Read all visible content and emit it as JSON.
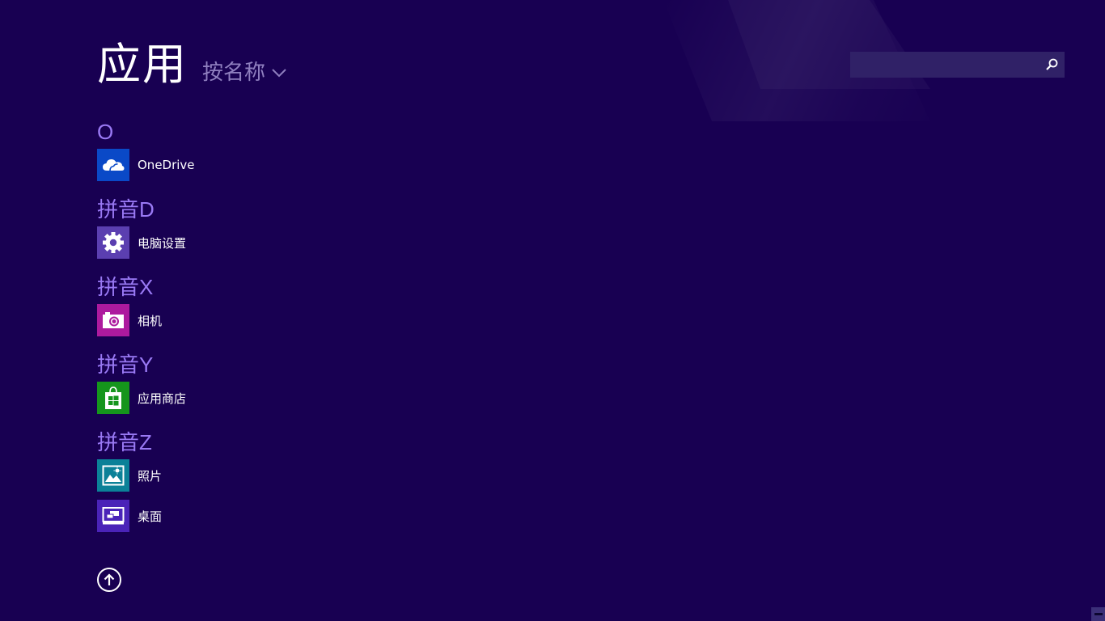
{
  "header": {
    "title": "应用",
    "sort_label": "按名称"
  },
  "search": {
    "placeholder": "",
    "value": "",
    "icon": "search-icon"
  },
  "colors": {
    "background": "#180052",
    "group_header": "#9a7af5",
    "onedrive_tile": "#0a49c7",
    "settings_tile": "#5b3fb0",
    "camera_tile": "#ad1a9e",
    "store_tile": "#15951c",
    "photos_tile": "#0b8198",
    "desktop_tile": "#4a23b8"
  },
  "groups": [
    {
      "letter": "O",
      "apps": [
        {
          "label": "OneDrive",
          "icon": "cloud-icon"
        }
      ]
    },
    {
      "letter": "拼音D",
      "apps": [
        {
          "label": "电脑设置",
          "icon": "gear-icon"
        }
      ]
    },
    {
      "letter": "拼音X",
      "apps": [
        {
          "label": "相机",
          "icon": "camera-icon"
        }
      ]
    },
    {
      "letter": "拼音Y",
      "apps": [
        {
          "label": "应用商店",
          "icon": "store-bag-icon"
        }
      ]
    },
    {
      "letter": "拼音Z",
      "apps": [
        {
          "label": "照片",
          "icon": "photo-icon"
        },
        {
          "label": "桌面",
          "icon": "desktop-icon"
        }
      ]
    }
  ],
  "footer": {
    "up_icon": "arrow-up-circle-icon"
  }
}
